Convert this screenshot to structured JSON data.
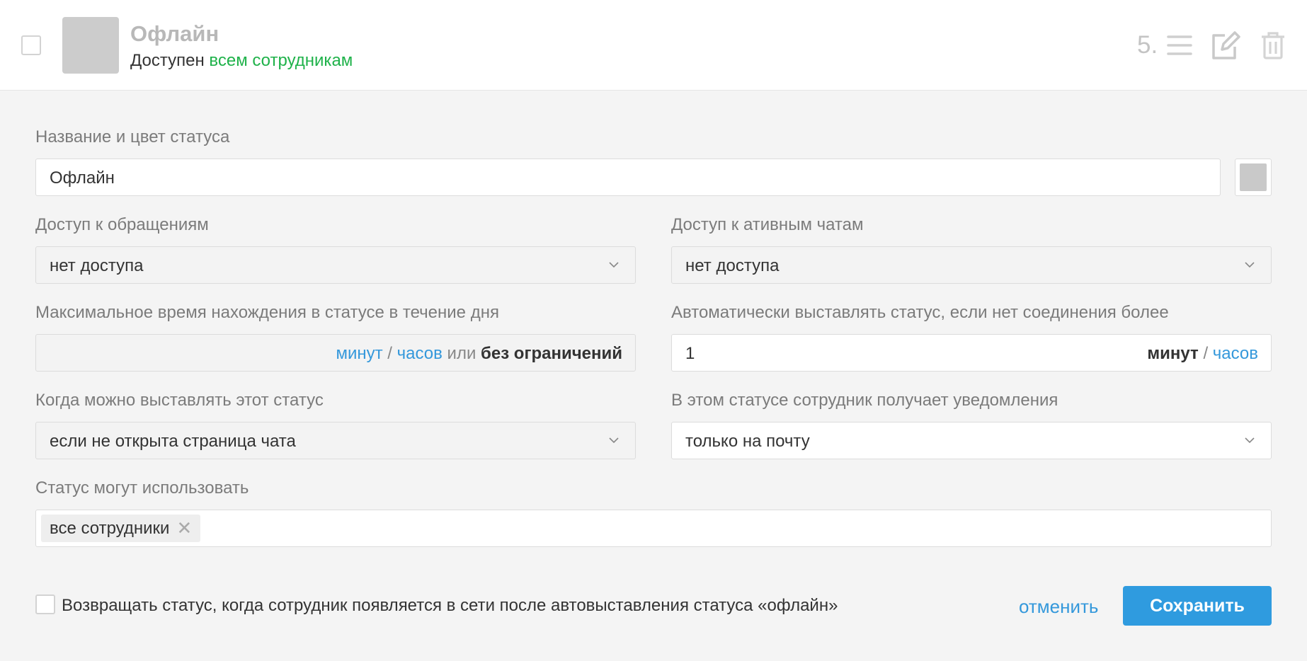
{
  "header": {
    "title": "Офлайн",
    "subtitle_prefix": "Доступен",
    "subtitle_link": "всем сотрудникам",
    "order_number": "5.",
    "icons": [
      "menu-icon",
      "edit-icon",
      "trash-icon"
    ],
    "color": "#cccccc"
  },
  "form": {
    "name_label": "Название и цвет статуса",
    "name_value": "Офлайн",
    "color_value": "#c9c9c9",
    "tickets_access_label": "Доступ к обращениям",
    "tickets_access_value": "нет доступа",
    "chats_access_label": "Доступ к ативным чатам",
    "chats_access_value": "нет доступа",
    "max_time_label": "Максимальное время нахождения в статусе в течение дня",
    "max_time_value": "",
    "max_time_units": {
      "minutes": "минут",
      "sep": "/",
      "hours": "часов",
      "or": "или",
      "unlimited": "без ограничений"
    },
    "auto_status_label": "Автоматически выставлять статус, если нет соединения более",
    "auto_status_value": "1",
    "auto_status_units": {
      "minutes": "минут",
      "sep": "/",
      "hours": "часов"
    },
    "when_label": "Когда можно выставлять этот статус",
    "when_value": "если не открыта страница чата",
    "notify_label": "В этом статусе сотрудник получает уведомления",
    "notify_value": "только на почту",
    "users_label": "Статус могут использовать",
    "users_tags": [
      "все сотрудники"
    ]
  },
  "footer": {
    "return_status_label": "Возвращать статус, когда сотрудник появляется в сети после автовыставления статуса «офлайн»",
    "cancel_label": "отменить",
    "save_label": "Сохранить"
  },
  "colors": {
    "accent": "#2f9bdf",
    "link": "#3498db",
    "green": "#1fb24a"
  }
}
